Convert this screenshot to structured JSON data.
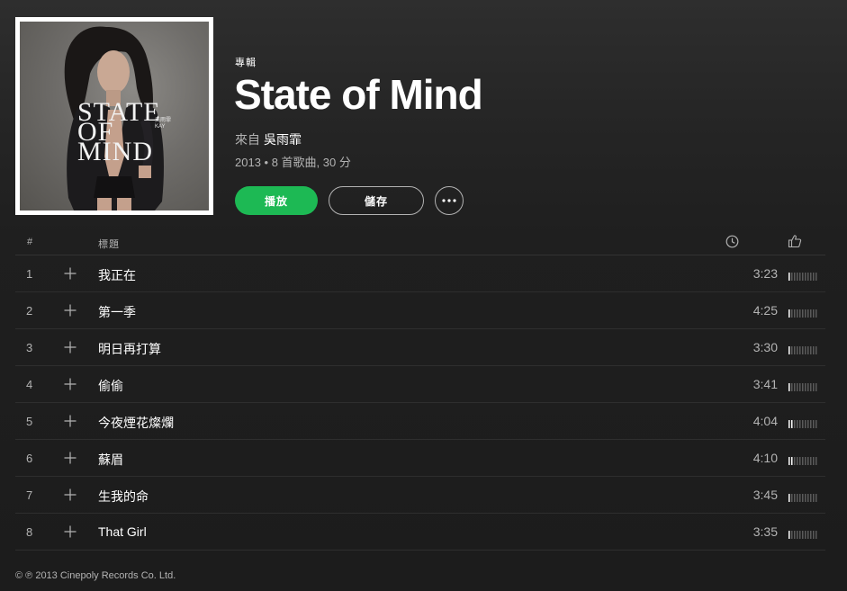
{
  "album": {
    "type_label": "專輯",
    "title": "State of Mind",
    "by_prefix": "來自",
    "artist": "吳雨霏",
    "stats": "2013 • 8 首歌曲, 30 分",
    "cover_text": {
      "line1": "STATE",
      "line2": "OF",
      "line3": "MIND",
      "artist_cn": "吳雨霏",
      "artist_en": "KAY"
    }
  },
  "buttons": {
    "play": "播放",
    "save": "儲存"
  },
  "tracklist": {
    "header": {
      "number": "#",
      "title": "標題"
    },
    "tracks": [
      {
        "number": "1",
        "title": "我正在",
        "duration": "3:23",
        "popularity": 1
      },
      {
        "number": "2",
        "title": "第一季",
        "duration": "4:25",
        "popularity": 1
      },
      {
        "number": "3",
        "title": "明日再打算",
        "duration": "3:30",
        "popularity": 1
      },
      {
        "number": "4",
        "title": "偷偷",
        "duration": "3:41",
        "popularity": 1
      },
      {
        "number": "5",
        "title": "今夜煙花燦爛",
        "duration": "4:04",
        "popularity": 2
      },
      {
        "number": "6",
        "title": "蘇眉",
        "duration": "4:10",
        "popularity": 2
      },
      {
        "number": "7",
        "title": "生我的命",
        "duration": "3:45",
        "popularity": 1
      },
      {
        "number": "8",
        "title": "That Girl",
        "duration": "3:35",
        "popularity": 1
      }
    ]
  },
  "footer": {
    "copyright": "© ℗ 2013 Cinepoly Records Co. Ltd."
  },
  "colors": {
    "accent": "#1db954",
    "text_muted": "#b3b3b3",
    "background": "#1c1c1c"
  }
}
